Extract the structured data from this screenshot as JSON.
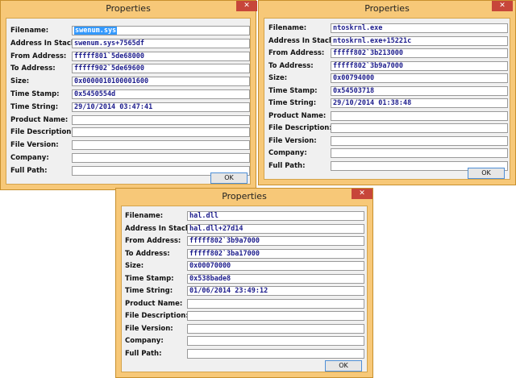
{
  "dialogs": [
    {
      "title": "Properties",
      "close_glyph": "✕",
      "ok_label": "OK",
      "fields": [
        {
          "label": "Filename:",
          "value": "swenum.sys",
          "selected": true
        },
        {
          "label": "Address In Stack:",
          "value": "swenum.sys+7565df"
        },
        {
          "label": "From Address:",
          "value": "fffff801`5de68000"
        },
        {
          "label": "To Address:",
          "value": "fffff902`5de69600"
        },
        {
          "label": "Size:",
          "value": "0x0000010100001600"
        },
        {
          "label": "Time Stamp:",
          "value": "0x5450554d"
        },
        {
          "label": "Time String:",
          "value": "29/10/2014 03:47:41"
        },
        {
          "label": "Product Name:",
          "value": ""
        },
        {
          "label": "File Description:",
          "value": ""
        },
        {
          "label": "File Version:",
          "value": ""
        },
        {
          "label": "Company:",
          "value": ""
        },
        {
          "label": "Full Path:",
          "value": ""
        }
      ]
    },
    {
      "title": "Properties",
      "close_glyph": "✕",
      "ok_label": "OK",
      "fields": [
        {
          "label": "Filename:",
          "value": "ntoskrnl.exe"
        },
        {
          "label": "Address In Stack:",
          "value": "ntoskrnl.exe+15221c"
        },
        {
          "label": "From Address:",
          "value": "fffff802`3b213000"
        },
        {
          "label": "To Address:",
          "value": "fffff802`3b9a7000"
        },
        {
          "label": "Size:",
          "value": "0x00794000"
        },
        {
          "label": "Time Stamp:",
          "value": "0x54503718"
        },
        {
          "label": "Time String:",
          "value": "29/10/2014 01:38:48"
        },
        {
          "label": "Product Name:",
          "value": ""
        },
        {
          "label": "File Description:",
          "value": ""
        },
        {
          "label": "File Version:",
          "value": ""
        },
        {
          "label": "Company:",
          "value": ""
        },
        {
          "label": "Full Path:",
          "value": ""
        }
      ]
    },
    {
      "title": "Properties",
      "close_glyph": "✕",
      "ok_label": "OK",
      "fields": [
        {
          "label": "Filename:",
          "value": "hal.dll"
        },
        {
          "label": "Address In Stack:",
          "value": "hal.dll+27d14"
        },
        {
          "label": "From Address:",
          "value": "fffff802`3b9a7000"
        },
        {
          "label": "To Address:",
          "value": "fffff802`3ba17000"
        },
        {
          "label": "Size:",
          "value": "0x00070000"
        },
        {
          "label": "Time Stamp:",
          "value": "0x538bade8"
        },
        {
          "label": "Time String:",
          "value": "01/06/2014 23:49:12"
        },
        {
          "label": "Product Name:",
          "value": ""
        },
        {
          "label": "File Description:",
          "value": ""
        },
        {
          "label": "File Version:",
          "value": ""
        },
        {
          "label": "Company:",
          "value": ""
        },
        {
          "label": "Full Path:",
          "value": ""
        }
      ]
    }
  ]
}
